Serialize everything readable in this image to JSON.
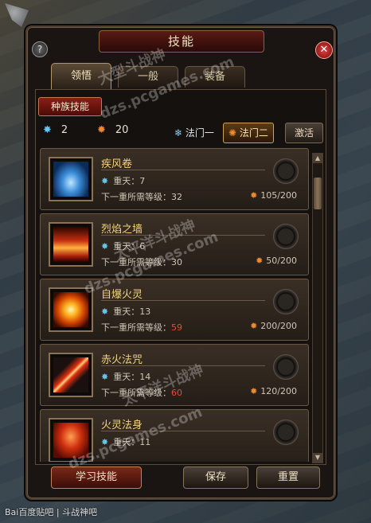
{
  "window": {
    "title": "技能"
  },
  "tabs": [
    {
      "label": "领悟"
    },
    {
      "label": "一般"
    },
    {
      "label": "装备"
    }
  ],
  "race_tab": "种族技能",
  "stats": {
    "stars": "2",
    "flames": "20"
  },
  "schools": [
    {
      "label": "法门一"
    },
    {
      "label": "法门二"
    }
  ],
  "activate_label": "激活",
  "skills": [
    {
      "name": "疾风卷",
      "level": "重天：7",
      "req_label": "下一重所需等级：",
      "req_value": "32",
      "req_red": false,
      "cost": "105/200"
    },
    {
      "name": "烈焰之墙",
      "level": "重天：6",
      "req_label": "下一重所需等级：",
      "req_value": "30",
      "req_red": false,
      "cost": "50/200"
    },
    {
      "name": "自爆火灵",
      "level": "重天：13",
      "req_label": "下一重所需等级：",
      "req_value": "59",
      "req_red": true,
      "cost": "200/200"
    },
    {
      "name": "赤火法咒",
      "level": "重天：14",
      "req_label": "下一重所需等级：",
      "req_value": "60",
      "req_red": true,
      "cost": "120/200"
    },
    {
      "name": "火灵法身",
      "level": "重天：11",
      "req_label": "",
      "req_value": "",
      "req_red": false,
      "cost": ""
    }
  ],
  "buttons": {
    "learn": "学习技能",
    "save": "保存",
    "reset": "重置"
  },
  "watermarks": [
    "大型斗战神",
    "dzs.pcgames.com",
    "太平洋斗战神"
  ],
  "footer": "Bai百度贴吧 | 斗战神吧",
  "icons": {
    "star": "star-icon",
    "flame": "flame-icon",
    "help": "help-icon",
    "close": "close-icon"
  }
}
